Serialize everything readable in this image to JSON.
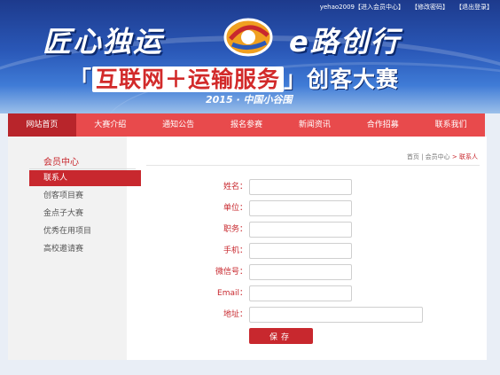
{
  "header": {
    "user_links": [
      "yehao2009【进入会员中心】",
      "【修改密码】",
      "【退出登录】"
    ],
    "slogan_left": "匠心独运",
    "slogan_right": "e路创行",
    "subtitle_open": "「",
    "subtitle_highlight": "互联网＋运输服务",
    "subtitle_rest": "」创客大赛",
    "year_line": "2015 · 中国小谷围",
    "colors": {
      "banner": "#2a58b8",
      "accent": "#c8282e"
    }
  },
  "nav": {
    "items": [
      "网站首页",
      "大赛介绍",
      "通知公告",
      "报名参赛",
      "新闻资讯",
      "合作招募",
      "联系我们"
    ],
    "active_index": 0
  },
  "sidebar": {
    "title": "会员中心",
    "items": [
      "联系人",
      "创客项目赛",
      "金点子大赛",
      "优秀在用项目",
      "高校邀请赛"
    ],
    "active_index": 0
  },
  "breadcrumb": {
    "home": "首页",
    "sep": " | ",
    "member": "会员中心",
    "arrow": " > ",
    "current": "联系人"
  },
  "form": {
    "fields": [
      {
        "label": "姓名：",
        "value": ""
      },
      {
        "label": "单位：",
        "value": ""
      },
      {
        "label": "职务：",
        "value": ""
      },
      {
        "label": "手机：",
        "value": ""
      },
      {
        "label": "微信号：",
        "value": ""
      },
      {
        "label": "Email：",
        "value": ""
      },
      {
        "label": "地址：",
        "value": ""
      }
    ],
    "save_label": "保存"
  }
}
